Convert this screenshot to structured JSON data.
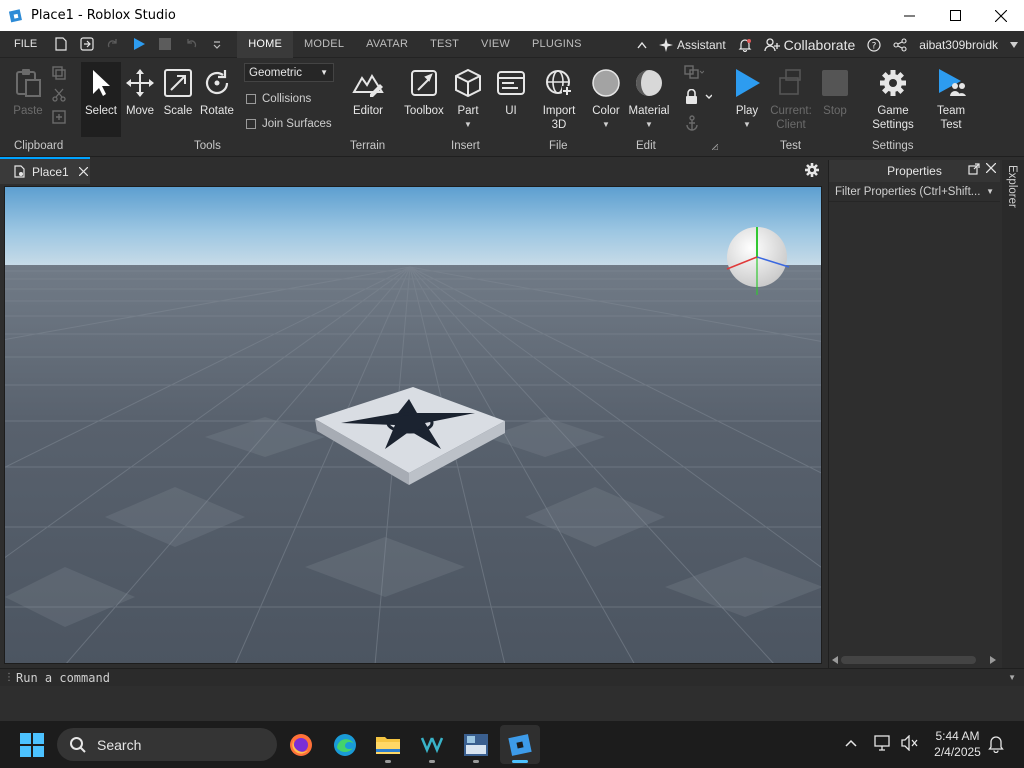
{
  "window": {
    "title": "Place1 - Roblox Studio",
    "controls": [
      "minimize-icon",
      "maximize-icon",
      "close-icon"
    ]
  },
  "menubar": {
    "file_label": "FILE",
    "tabs": [
      {
        "label": "HOME",
        "active": true
      },
      {
        "label": "MODEL",
        "active": false
      },
      {
        "label": "AVATAR",
        "active": false
      },
      {
        "label": "TEST",
        "active": false
      },
      {
        "label": "VIEW",
        "active": false
      },
      {
        "label": "PLUGINS",
        "active": false
      }
    ],
    "assistant_label": "Assistant",
    "collaborate_label": "Collaborate",
    "username": "aibat309broidk"
  },
  "ribbon": {
    "clipboard": {
      "paste": "Paste",
      "group": "Clipboard"
    },
    "tools": {
      "select": "Select",
      "move": "Move",
      "scale": "Scale",
      "rotate": "Rotate",
      "mode": "Geometric",
      "collisions": "Collisions",
      "join_surfaces": "Join Surfaces",
      "group": "Tools"
    },
    "terrain": {
      "editor": "Editor",
      "group": "Terrain"
    },
    "insert": {
      "toolbox": "Toolbox",
      "part": "Part",
      "ui": "UI",
      "group": "Insert"
    },
    "file": {
      "import_line1": "Import",
      "import_line2": "3D",
      "group": "File"
    },
    "edit": {
      "color": "Color",
      "material": "Material",
      "group": "Edit"
    },
    "test": {
      "play": "Play",
      "current_line1": "Current:",
      "current_line2": "Client",
      "stop": "Stop",
      "group": "Test"
    },
    "settings": {
      "game_line1": "Game",
      "game_line2": "Settings",
      "team_line1": "Team",
      "team_line2": "Test",
      "group": "Settings"
    }
  },
  "document": {
    "tab_label": "Place1"
  },
  "properties": {
    "title": "Properties",
    "filter_placeholder": "Filter Properties (Ctrl+Shift..."
  },
  "explorer_tab": "Explorer",
  "command_bar": {
    "placeholder": "Run a command"
  },
  "taskbar": {
    "search_label": "Search",
    "apps": [
      "firefox-icon",
      "edge-icon",
      "file-explorer-icon",
      "vscode-icon",
      "sdk-icon",
      "roblox-studio-icon"
    ],
    "time": "5:44 AM",
    "date": "2/4/2025"
  },
  "colors": {
    "accent": "#00a2ff",
    "play_blue": "#2d9cf0",
    "ribbon_bg": "#2e2e2e",
    "taskbar_bg": "#1c1c1c"
  }
}
